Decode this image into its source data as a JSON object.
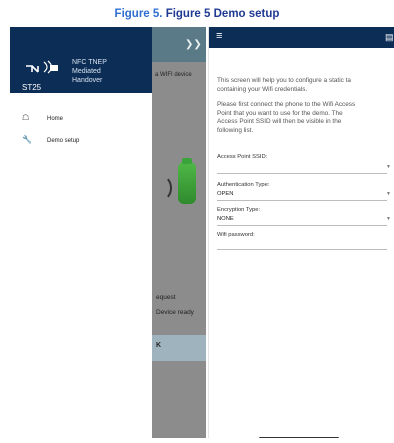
{
  "caption": {
    "label": "Figure 5.",
    "title": "Figure 5 Demo setup"
  },
  "left_phone": {
    "background": {
      "header_fragment": "a WIFI device",
      "status_request": "equest",
      "status_ready": "Device ready",
      "button_fragment": "K"
    },
    "drawer": {
      "logo_text": "ST25",
      "title_lines": [
        "NFC TNEP",
        "Mediated",
        "Handover"
      ],
      "items": [
        {
          "icon": "home-icon",
          "label": "Home"
        },
        {
          "icon": "wrench-icon",
          "label": "Demo setup"
        }
      ]
    }
  },
  "right_phone": {
    "intro_lines": [
      "This screen will help you to configure a static ta",
      "containing your Wifi credentials."
    ],
    "instruction_lines": [
      "Please first connect the phone to the Wifi Access",
      "Point that you want to use for the demo. The",
      "Access Point SSID will then be visible in the",
      "following list."
    ],
    "fields": {
      "ssid_label": "Access Point SSID:",
      "auth_label": "Authentication Type:",
      "auth_value": "OPEN",
      "enc_label": "Encryption Type:",
      "enc_value": "NONE",
      "password_label": "Wifi password:"
    }
  },
  "colors": {
    "caption_label": "#2f6fd1",
    "caption_title": "#1f3a93",
    "app_bar": "#0b2d56",
    "battery": "#4fb847"
  }
}
